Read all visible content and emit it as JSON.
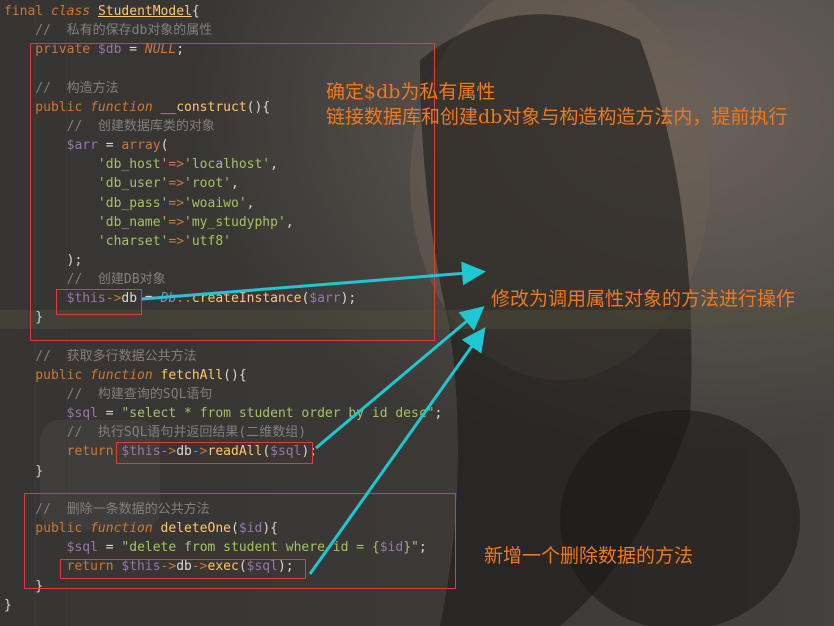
{
  "code_lines": [
    [
      [
        "kw",
        "final "
      ],
      [
        "kwi",
        "class "
      ],
      [
        "cls",
        "StudentModel"
      ],
      [
        "pln",
        "{"
      ]
    ],
    [
      [
        "cmt",
        "    //  私有的保存db对象的属性"
      ]
    ],
    [
      [
        "kw",
        "    private "
      ],
      [
        "var",
        "$db"
      ],
      [
        "pln",
        " = "
      ],
      [
        "nul",
        "NULL"
      ],
      [
        "pln",
        ";"
      ]
    ],
    [
      [
        "pln",
        ""
      ]
    ],
    [
      [
        "cmt",
        "    //  构造方法"
      ]
    ],
    [
      [
        "kw",
        "    public "
      ],
      [
        "kwi",
        "function "
      ],
      [
        "fn",
        "__construct"
      ],
      [
        "pln",
        "(){"
      ]
    ],
    [
      [
        "cmt",
        "        //  创建数据库类的对象"
      ]
    ],
    [
      [
        "pln",
        "        "
      ],
      [
        "var",
        "$arr"
      ],
      [
        "pln",
        " = "
      ],
      [
        "kw",
        "array"
      ],
      [
        "pln",
        "("
      ]
    ],
    [
      [
        "str",
        "            'db_host'"
      ],
      [
        "kw",
        "=>"
      ],
      [
        "str",
        "'localhost'"
      ],
      [
        "pln",
        ","
      ]
    ],
    [
      [
        "str",
        "            'db_user'"
      ],
      [
        "kw",
        "=>"
      ],
      [
        "str",
        "'root'"
      ],
      [
        "pln",
        ","
      ]
    ],
    [
      [
        "str",
        "            'db_pass'"
      ],
      [
        "kw",
        "=>"
      ],
      [
        "str",
        "'woaiwo'"
      ],
      [
        "pln",
        ","
      ]
    ],
    [
      [
        "str",
        "            'db_name'"
      ],
      [
        "kw",
        "=>"
      ],
      [
        "str",
        "'my_studyphp'"
      ],
      [
        "pln",
        ","
      ]
    ],
    [
      [
        "str",
        "            'charset'"
      ],
      [
        "kw",
        "=>"
      ],
      [
        "str",
        "'utf8'"
      ]
    ],
    [
      [
        "pln",
        "        );"
      ]
    ],
    [
      [
        "cmt",
        "        //  创建DB对象"
      ]
    ],
    [
      [
        "pln",
        "        "
      ],
      [
        "var",
        "$this"
      ],
      [
        "kw",
        "->"
      ],
      [
        "pln",
        "db"
      ],
      [
        "pln",
        " = "
      ],
      [
        "cln",
        "Db"
      ],
      [
        "kw",
        "::"
      ],
      [
        "fn",
        "createInstance"
      ],
      [
        "pln",
        "("
      ],
      [
        "var",
        "$arr"
      ],
      [
        "pln",
        ");"
      ]
    ],
    [
      [
        "pln",
        "    }"
      ]
    ],
    [
      [
        "pln",
        ""
      ]
    ],
    [
      [
        "cmt",
        "    //  获取多行数据公共方法"
      ]
    ],
    [
      [
        "kw",
        "    public "
      ],
      [
        "kwi",
        "function "
      ],
      [
        "fn",
        "fetchAll"
      ],
      [
        "pln",
        "(){"
      ]
    ],
    [
      [
        "cmt",
        "        //  构建查询的SQL语句"
      ]
    ],
    [
      [
        "pln",
        "        "
      ],
      [
        "var",
        "$sql"
      ],
      [
        "pln",
        " = "
      ],
      [
        "str",
        "\"select * from student order by id desc\""
      ],
      [
        "pln",
        ";"
      ]
    ],
    [
      [
        "cmt",
        "        //  执行SQL语句并返回结果(二维数组)"
      ]
    ],
    [
      [
        "kw",
        "        return "
      ],
      [
        "var",
        "$this"
      ],
      [
        "kw",
        "->"
      ],
      [
        "pln",
        "db"
      ],
      [
        "kw",
        "->"
      ],
      [
        "fn",
        "readAll"
      ],
      [
        "pln",
        "("
      ],
      [
        "var",
        "$sql"
      ],
      [
        "pln",
        ");"
      ]
    ],
    [
      [
        "pln",
        "    }"
      ]
    ],
    [
      [
        "pln",
        ""
      ]
    ],
    [
      [
        "cmt",
        "    //  删除一条数据的公共方法"
      ]
    ],
    [
      [
        "kw",
        "    public "
      ],
      [
        "kwi",
        "function "
      ],
      [
        "fn",
        "deleteOne"
      ],
      [
        "pln",
        "("
      ],
      [
        "var",
        "$id"
      ],
      [
        "pln",
        "){"
      ]
    ],
    [
      [
        "pln",
        "        "
      ],
      [
        "var",
        "$sql"
      ],
      [
        "pln",
        " = "
      ],
      [
        "str",
        "\"delete from student where id = {"
      ],
      [
        "var",
        "$id"
      ],
      [
        "str",
        "}\""
      ],
      [
        "pln",
        ";"
      ]
    ],
    [
      [
        "kw",
        "        return "
      ],
      [
        "var",
        "$this"
      ],
      [
        "kw",
        "->"
      ],
      [
        "pln",
        "db"
      ],
      [
        "kw",
        "->"
      ],
      [
        "fn",
        "exec"
      ],
      [
        "pln",
        "("
      ],
      [
        "var",
        "$sql"
      ],
      [
        "pln",
        ");"
      ]
    ],
    [
      [
        "pln",
        "    }"
      ]
    ],
    [
      [
        "pln",
        "}"
      ]
    ]
  ],
  "annotations": {
    "note1_line1": "确定$db为私有属性",
    "note1_line2": "链接数据库和创建db对象与构造构造方法内，提前执行",
    "note2": "修改为调用属性对象的方法进行操作",
    "note3": "新增一个删除数据的方法"
  },
  "colors": {
    "annotation_text": "#f0781e",
    "box_border": "#e8383c",
    "arrow": "#1ec8d2"
  }
}
